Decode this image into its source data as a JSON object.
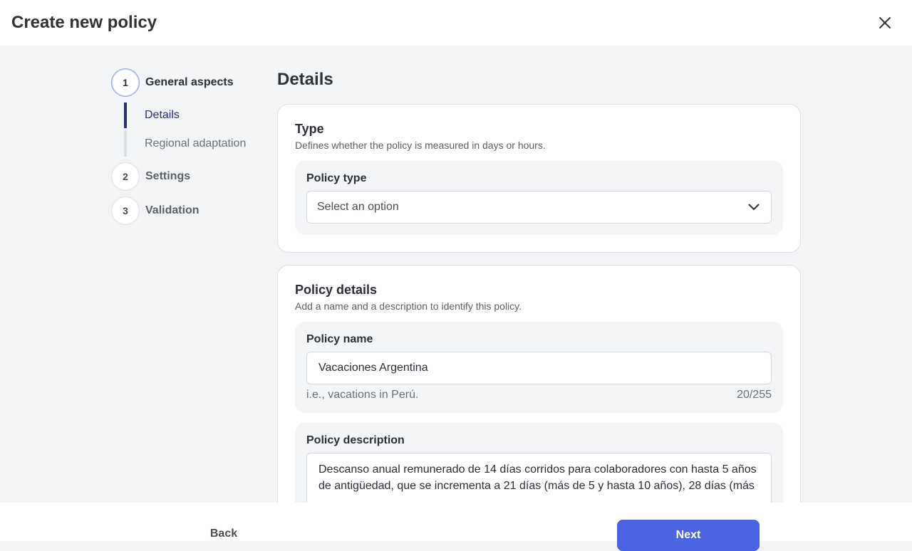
{
  "header": {
    "title": "Create new policy",
    "close_icon": "close-icon"
  },
  "stepper": {
    "steps": [
      {
        "number": "1",
        "label": "General aspects",
        "active": true,
        "substeps": [
          {
            "label": "Details",
            "active": true
          },
          {
            "label": "Regional adaptation",
            "active": false
          }
        ]
      },
      {
        "number": "2",
        "label": "Settings",
        "active": false
      },
      {
        "number": "3",
        "label": "Validation",
        "active": false
      }
    ]
  },
  "main": {
    "title": "Details",
    "type_card": {
      "title": "Type",
      "subtitle": "Defines whether the policy is measured in days or hours.",
      "policy_type": {
        "label": "Policy type",
        "placeholder": "Select an option"
      }
    },
    "details_card": {
      "title": "Policy details",
      "subtitle": "Add a name and a description to identify this policy.",
      "policy_name": {
        "label": "Policy name",
        "value": "Vacaciones Argentina",
        "helper": "i.e., vacations in Perú.",
        "counter": "20/255"
      },
      "policy_description": {
        "label": "Policy description",
        "value": "Descanso anual remunerado de 14 días corridos para colaboradores con hasta 5 años de antigüedad, que se incrementa a 21 días (más de 5 y hasta 10 años), 28 días (más"
      }
    }
  },
  "footer": {
    "back_label": "Back",
    "next_label": "Next"
  },
  "colors": {
    "accent": "#4a63e0",
    "active_step": "#28307a"
  }
}
